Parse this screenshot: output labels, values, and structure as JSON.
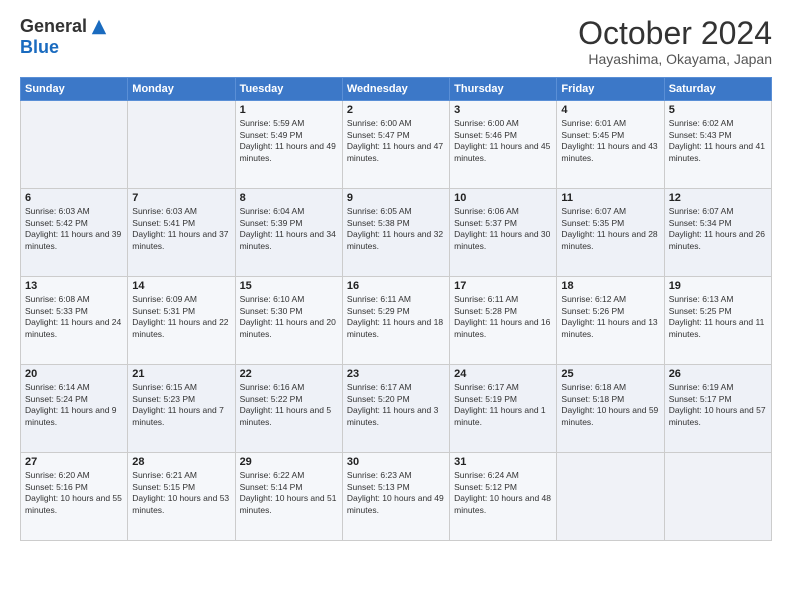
{
  "logo": {
    "general": "General",
    "blue": "Blue"
  },
  "header": {
    "month": "October 2024",
    "location": "Hayashima, Okayama, Japan"
  },
  "weekdays": [
    "Sunday",
    "Monday",
    "Tuesday",
    "Wednesday",
    "Thursday",
    "Friday",
    "Saturday"
  ],
  "weeks": [
    [
      {
        "day": "",
        "sunrise": "",
        "sunset": "",
        "daylight": ""
      },
      {
        "day": "",
        "sunrise": "",
        "sunset": "",
        "daylight": ""
      },
      {
        "day": "1",
        "sunrise": "Sunrise: 5:59 AM",
        "sunset": "Sunset: 5:49 PM",
        "daylight": "Daylight: 11 hours and 49 minutes."
      },
      {
        "day": "2",
        "sunrise": "Sunrise: 6:00 AM",
        "sunset": "Sunset: 5:47 PM",
        "daylight": "Daylight: 11 hours and 47 minutes."
      },
      {
        "day": "3",
        "sunrise": "Sunrise: 6:00 AM",
        "sunset": "Sunset: 5:46 PM",
        "daylight": "Daylight: 11 hours and 45 minutes."
      },
      {
        "day": "4",
        "sunrise": "Sunrise: 6:01 AM",
        "sunset": "Sunset: 5:45 PM",
        "daylight": "Daylight: 11 hours and 43 minutes."
      },
      {
        "day": "5",
        "sunrise": "Sunrise: 6:02 AM",
        "sunset": "Sunset: 5:43 PM",
        "daylight": "Daylight: 11 hours and 41 minutes."
      }
    ],
    [
      {
        "day": "6",
        "sunrise": "Sunrise: 6:03 AM",
        "sunset": "Sunset: 5:42 PM",
        "daylight": "Daylight: 11 hours and 39 minutes."
      },
      {
        "day": "7",
        "sunrise": "Sunrise: 6:03 AM",
        "sunset": "Sunset: 5:41 PM",
        "daylight": "Daylight: 11 hours and 37 minutes."
      },
      {
        "day": "8",
        "sunrise": "Sunrise: 6:04 AM",
        "sunset": "Sunset: 5:39 PM",
        "daylight": "Daylight: 11 hours and 34 minutes."
      },
      {
        "day": "9",
        "sunrise": "Sunrise: 6:05 AM",
        "sunset": "Sunset: 5:38 PM",
        "daylight": "Daylight: 11 hours and 32 minutes."
      },
      {
        "day": "10",
        "sunrise": "Sunrise: 6:06 AM",
        "sunset": "Sunset: 5:37 PM",
        "daylight": "Daylight: 11 hours and 30 minutes."
      },
      {
        "day": "11",
        "sunrise": "Sunrise: 6:07 AM",
        "sunset": "Sunset: 5:35 PM",
        "daylight": "Daylight: 11 hours and 28 minutes."
      },
      {
        "day": "12",
        "sunrise": "Sunrise: 6:07 AM",
        "sunset": "Sunset: 5:34 PM",
        "daylight": "Daylight: 11 hours and 26 minutes."
      }
    ],
    [
      {
        "day": "13",
        "sunrise": "Sunrise: 6:08 AM",
        "sunset": "Sunset: 5:33 PM",
        "daylight": "Daylight: 11 hours and 24 minutes."
      },
      {
        "day": "14",
        "sunrise": "Sunrise: 6:09 AM",
        "sunset": "Sunset: 5:31 PM",
        "daylight": "Daylight: 11 hours and 22 minutes."
      },
      {
        "day": "15",
        "sunrise": "Sunrise: 6:10 AM",
        "sunset": "Sunset: 5:30 PM",
        "daylight": "Daylight: 11 hours and 20 minutes."
      },
      {
        "day": "16",
        "sunrise": "Sunrise: 6:11 AM",
        "sunset": "Sunset: 5:29 PM",
        "daylight": "Daylight: 11 hours and 18 minutes."
      },
      {
        "day": "17",
        "sunrise": "Sunrise: 6:11 AM",
        "sunset": "Sunset: 5:28 PM",
        "daylight": "Daylight: 11 hours and 16 minutes."
      },
      {
        "day": "18",
        "sunrise": "Sunrise: 6:12 AM",
        "sunset": "Sunset: 5:26 PM",
        "daylight": "Daylight: 11 hours and 13 minutes."
      },
      {
        "day": "19",
        "sunrise": "Sunrise: 6:13 AM",
        "sunset": "Sunset: 5:25 PM",
        "daylight": "Daylight: 11 hours and 11 minutes."
      }
    ],
    [
      {
        "day": "20",
        "sunrise": "Sunrise: 6:14 AM",
        "sunset": "Sunset: 5:24 PM",
        "daylight": "Daylight: 11 hours and 9 minutes."
      },
      {
        "day": "21",
        "sunrise": "Sunrise: 6:15 AM",
        "sunset": "Sunset: 5:23 PM",
        "daylight": "Daylight: 11 hours and 7 minutes."
      },
      {
        "day": "22",
        "sunrise": "Sunrise: 6:16 AM",
        "sunset": "Sunset: 5:22 PM",
        "daylight": "Daylight: 11 hours and 5 minutes."
      },
      {
        "day": "23",
        "sunrise": "Sunrise: 6:17 AM",
        "sunset": "Sunset: 5:20 PM",
        "daylight": "Daylight: 11 hours and 3 minutes."
      },
      {
        "day": "24",
        "sunrise": "Sunrise: 6:17 AM",
        "sunset": "Sunset: 5:19 PM",
        "daylight": "Daylight: 11 hours and 1 minute."
      },
      {
        "day": "25",
        "sunrise": "Sunrise: 6:18 AM",
        "sunset": "Sunset: 5:18 PM",
        "daylight": "Daylight: 10 hours and 59 minutes."
      },
      {
        "day": "26",
        "sunrise": "Sunrise: 6:19 AM",
        "sunset": "Sunset: 5:17 PM",
        "daylight": "Daylight: 10 hours and 57 minutes."
      }
    ],
    [
      {
        "day": "27",
        "sunrise": "Sunrise: 6:20 AM",
        "sunset": "Sunset: 5:16 PM",
        "daylight": "Daylight: 10 hours and 55 minutes."
      },
      {
        "day": "28",
        "sunrise": "Sunrise: 6:21 AM",
        "sunset": "Sunset: 5:15 PM",
        "daylight": "Daylight: 10 hours and 53 minutes."
      },
      {
        "day": "29",
        "sunrise": "Sunrise: 6:22 AM",
        "sunset": "Sunset: 5:14 PM",
        "daylight": "Daylight: 10 hours and 51 minutes."
      },
      {
        "day": "30",
        "sunrise": "Sunrise: 6:23 AM",
        "sunset": "Sunset: 5:13 PM",
        "daylight": "Daylight: 10 hours and 49 minutes."
      },
      {
        "day": "31",
        "sunrise": "Sunrise: 6:24 AM",
        "sunset": "Sunset: 5:12 PM",
        "daylight": "Daylight: 10 hours and 48 minutes."
      },
      {
        "day": "",
        "sunrise": "",
        "sunset": "",
        "daylight": ""
      },
      {
        "day": "",
        "sunrise": "",
        "sunset": "",
        "daylight": ""
      }
    ]
  ]
}
